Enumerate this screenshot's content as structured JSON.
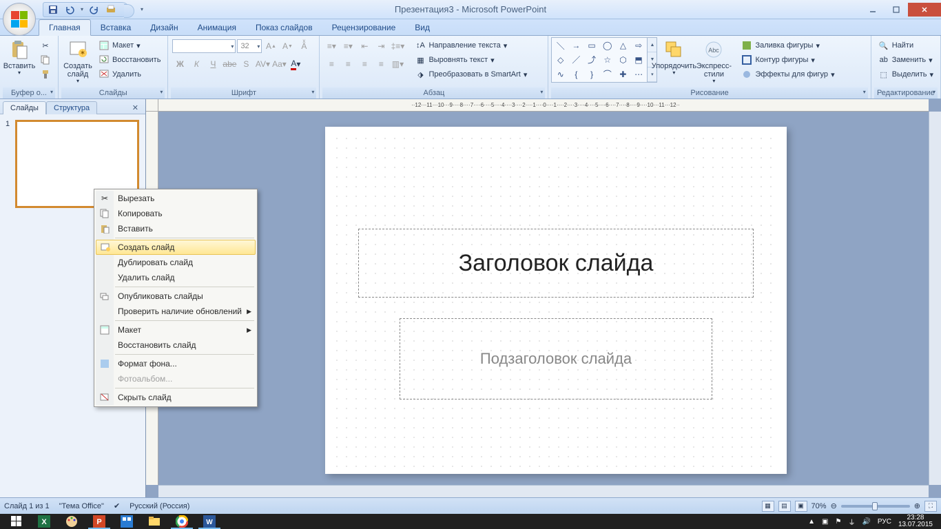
{
  "title": "Презентация3 - Microsoft PowerPoint",
  "tabs": {
    "home": "Главная",
    "insert": "Вставка",
    "design": "Дизайн",
    "animation": "Анимация",
    "slideshow": "Показ слайдов",
    "review": "Рецензирование",
    "view": "Вид"
  },
  "ribbon": {
    "clipboard": {
      "label": "Буфер о...",
      "paste": "Вставить"
    },
    "slides": {
      "label": "Слайды",
      "new_slide": "Создать\nслайд",
      "layout": "Макет",
      "reset": "Восстановить",
      "delete": "Удалить"
    },
    "font": {
      "label": "Шрифт",
      "size": "32"
    },
    "paragraph": {
      "label": "Абзац",
      "text_dir": "Направление текста",
      "align": "Выровнять текст",
      "smartart": "Преобразовать в SmartArt"
    },
    "drawing": {
      "label": "Рисование",
      "arrange": "Упорядочить",
      "quick_styles": "Экспресс-стили",
      "fill": "Заливка фигуры",
      "outline": "Контур фигуры",
      "effects": "Эффекты для фигур"
    },
    "editing": {
      "label": "Редактирование",
      "find": "Найти",
      "replace": "Заменить",
      "select": "Выделить"
    }
  },
  "slides_panel": {
    "tab_slides": "Слайды",
    "tab_outline": "Структура",
    "slide_number": "1"
  },
  "ruler_h": "··12···11···10···9····8····7····6····5····4····3····2····1····0····1····2····3····4····5····6····7····8····9····10···11···12··",
  "slide": {
    "title_placeholder": "Заголовок слайда",
    "subtitle_placeholder": "Подзаголовок слайда"
  },
  "context_menu": {
    "cut": "Вырезать",
    "copy": "Копировать",
    "paste": "Вставить",
    "new_slide": "Создать слайд",
    "duplicate": "Дублировать слайд",
    "delete": "Удалить слайд",
    "publish": "Опубликовать слайды",
    "check_updates": "Проверить наличие обновлений",
    "layout": "Макет",
    "reset": "Восстановить слайд",
    "format_bg": "Формат фона...",
    "photo_album": "Фотоальбом...",
    "hide": "Скрыть слайд"
  },
  "status": {
    "slide_info": "Слайд 1 из 1",
    "theme": "\"Тема Office\"",
    "language": "Русский (Россия)",
    "zoom": "70%"
  },
  "taskbar": {
    "lang": "РУС",
    "time": "23:28",
    "date": "13.07.2015"
  }
}
